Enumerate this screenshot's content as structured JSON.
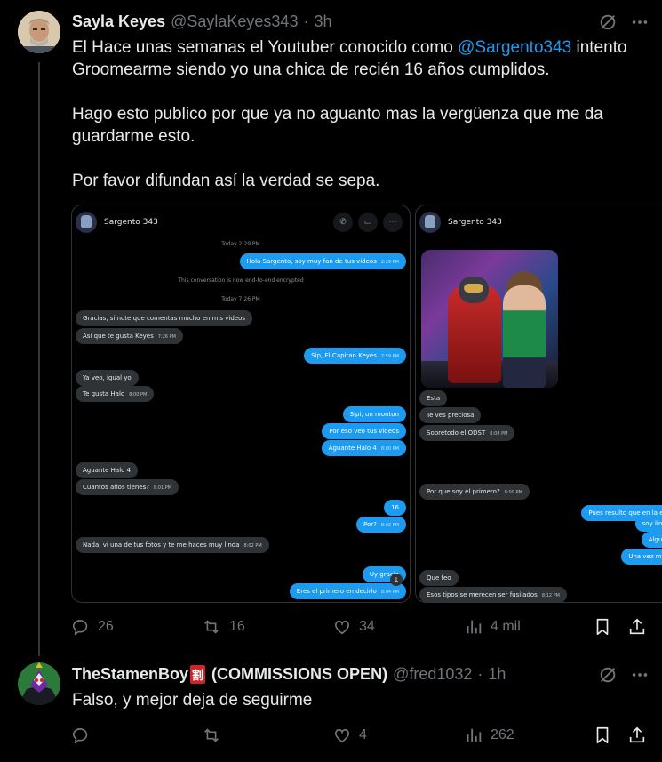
{
  "tweet1": {
    "author_name": "Sayla Keyes",
    "author_handle": "@SaylaKeyes343",
    "separator": "·",
    "time": "3h",
    "text_line1_a": "El Hace unas semanas el Youtuber conocido como ",
    "mention": "@Sargento343",
    "text_line1_b": "  intento Groomearme siendo yo una chica de recién 16 años cumplidos.",
    "paragraph2": "Hago esto publico por que ya no aguanto mas la vergüenza que me da guardarme esto.",
    "paragraph3": "Por favor difundan así la verdad se sepa.",
    "stats": {
      "replies": "26",
      "reposts": "16",
      "likes": "34",
      "views": "4 mil"
    }
  },
  "screenshot1": {
    "contact": "Sargento 343",
    "messages": [
      {
        "kind": "sys",
        "text": "Today 2:29 PM"
      },
      {
        "kind": "out",
        "text": "Hola Sargento, soy muy fan de tus videos",
        "ts": "2:29 PM"
      },
      {
        "kind": "sys",
        "text": "This conversation is now end-to-end encrypted"
      },
      {
        "kind": "sys",
        "text": "Today 7:26 PM"
      },
      {
        "kind": "in",
        "text": "Gracias, si note que comentas mucho en mis videos",
        "ts": ""
      },
      {
        "kind": "in",
        "text": "Así que te gusta Keyes",
        "ts": "7:26 PM"
      },
      {
        "kind": "out",
        "text": "Sip, El Capitan Keyes",
        "ts": "7:59 PM"
      },
      {
        "kind": "in",
        "text": "Ya veo, igual yo",
        "ts": ""
      },
      {
        "kind": "in",
        "text": "Te gusta Halo",
        "ts": "8:00 PM"
      },
      {
        "kind": "out",
        "text": "Sipi, un monton",
        "ts": ""
      },
      {
        "kind": "out",
        "text": "Por eso veo tus videos",
        "ts": ""
      },
      {
        "kind": "out",
        "text": "Aguante Halo 4",
        "ts": "8:00 PM"
      },
      {
        "kind": "in",
        "text": "Aguante Halo 4",
        "ts": ""
      },
      {
        "kind": "in",
        "text": "Cuantos años tienes?",
        "ts": "8:01 PM"
      },
      {
        "kind": "out",
        "text": "16",
        "ts": ""
      },
      {
        "kind": "out",
        "text": "Por?",
        "ts": "8:02 PM"
      },
      {
        "kind": "in",
        "text": "Nada, vi una de tus fotos y te me haces muy linda",
        "ts": "8:02 PM"
      },
      {
        "kind": "out",
        "text": "Uy gracia",
        "ts": ""
      },
      {
        "kind": "out",
        "text": "Eres el primero en decirlo",
        "ts": "8:04 PM"
      }
    ]
  },
  "screenshot2": {
    "contact": "Sargento 343",
    "messages": [
      {
        "kind": "in",
        "text": "Esta",
        "ts": ""
      },
      {
        "kind": "in",
        "text": "Te ves preciosa",
        "ts": ""
      },
      {
        "kind": "in",
        "text": "Sobretodo el ODST",
        "ts": "8:08 PM"
      },
      {
        "kind": "in",
        "text": "Por que soy el primero?",
        "ts": "8:09 PM"
      },
      {
        "kind": "out",
        "text": "Pues resulto que en la esc",
        "ts": ""
      },
      {
        "kind": "out",
        "text": "soy linda",
        "ts": ""
      },
      {
        "kind": "out",
        "text": "Alguno",
        "ts": ""
      },
      {
        "kind": "out",
        "text": "Una vez me r",
        "ts": ""
      },
      {
        "kind": "in",
        "text": "Que feo",
        "ts": ""
      },
      {
        "kind": "in",
        "text": "Esos tipos se merecen ser fusilados",
        "ts": "8:12 PM"
      }
    ]
  },
  "tweet2": {
    "author_name": "TheStamenBoy",
    "badge": "割",
    "author_suffix": " (COMMISSIONS OPEN)",
    "author_handle": "@fred1032",
    "separator": "·",
    "time": "1h",
    "text": "Falso, y mejor deja de seguirme",
    "stats": {
      "replies": "",
      "reposts": "",
      "likes": "4",
      "views": "262"
    }
  },
  "colors": {
    "accent": "#1d9bf0",
    "muted": "#71767b",
    "text": "#e7e9ea",
    "background": "#000000"
  }
}
